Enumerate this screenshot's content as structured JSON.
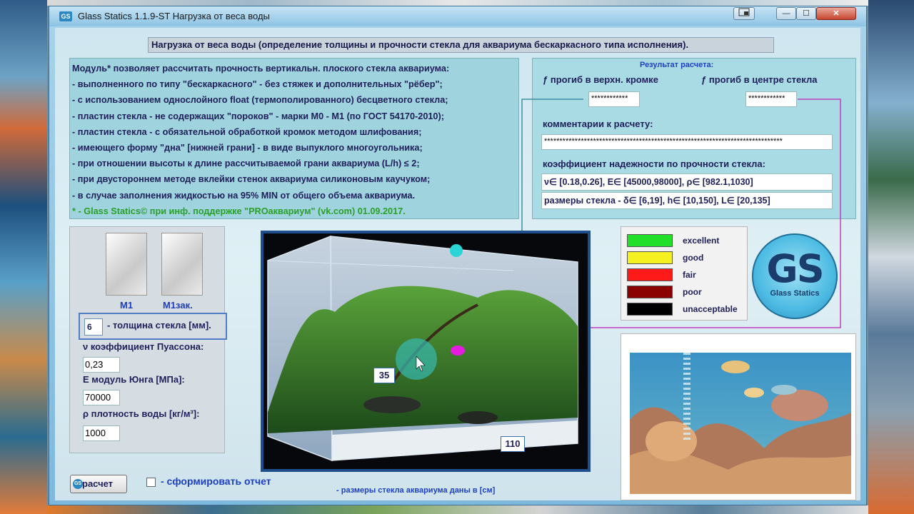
{
  "window": {
    "app_icon": "GS",
    "title": "Glass Statics 1.1.9-ST Нагрузка от веса воды",
    "controls": {
      "minimize": "—",
      "maximize": "☐",
      "close": "✕"
    }
  },
  "header": "Нагрузка от веса воды (определение толщины и прочности стекла для аквариума бескаркасного типа исполнения).",
  "description": {
    "lines": [
      "Модуль* позволяет рассчитать прочность вертикальн. плоского стекла аквариума:",
      "- выполненного  по типу \"бескаркасного\"  -  без стяжек и дополнительных \"рёбер\";",
      "- с использованием однослойного float (термополированного) бесцветного стекла;",
      "- пластин стекла  -  не содержащих \"пороков\" - марки М0 - М1 (по ГОСТ 54170-2010);",
      "- пластин стекла  -  с  обязательной  обработкой  кромок  методом  шлифования;",
      "- имеющего форму   \"дна\" [нижней грани]  -  в  виде  выпуклого многоугольника;",
      "- при отношении  высоты  к  длине  рассчитываемой грани аквариума (L/h) ≤ 2;",
      "- при двустороннем методе вклейки стенок аквариума силиконовым каучуком;",
      "- в случае  заполнения  жидкостью  на  95% MIN  от  общего объема аквариума."
    ],
    "credit": "* - Glass Statics© при инф. поддержке \"PROаквариум\" (vk.com) 01.09.2017."
  },
  "results": {
    "title": "Результат расчета:",
    "deflection_top_label": "ƒ прогиб в верхн. кромке",
    "deflection_top_value": "************",
    "deflection_center_label": "ƒ прогиб в  центре стекла",
    "deflection_center_value": "************",
    "comments_label": "комментарии к расчету:",
    "comments_value": "******************************************************************************",
    "reliability_label": "коэффициент надежности по прочности стекла:",
    "ranges_value": "ν∈ [0.18,0.26],  E∈ [45000,98000],  ρ∈ [982.1,1030]",
    "dimensions_value": "размеры стекла - δ∈ [6,19],  h∈ [10,150],  L∈ [20,135]"
  },
  "glass": {
    "grade_m1": "М1",
    "grade_m1_temp": "М1зак.",
    "thickness_value": "6",
    "thickness_label": "- толщина стекла [мм].",
    "poisson_label": "ν коэффициент   Пуассона:",
    "poisson_value": "0,23",
    "young_label": "E     модуль  Юнга   [МПа]:",
    "young_value": "70000",
    "density_label": "ρ плотность  воды   [кг/м³]:",
    "density_value": "1000"
  },
  "tank": {
    "height_value": "35",
    "length_value": "110"
  },
  "legend": [
    {
      "label": "excellent",
      "color": "#22e02a"
    },
    {
      "label": "good",
      "color": "#f5f01f"
    },
    {
      "label": "fair",
      "color": "#ff1a1a"
    },
    {
      "label": "poor",
      "color": "#8b0000"
    },
    {
      "label": "unacceptable",
      "color": "#000000"
    }
  ],
  "logo": {
    "letters": "GS",
    "caption": "Glass Statics"
  },
  "actions": {
    "calc_button": "расчет",
    "calc_icon": "GS",
    "report_label": "- сформировать отчет"
  },
  "footnote": "- размеры стекла аквариума даны в [см]",
  "colors": {
    "accent_blue": "#1e40c0",
    "text_navy": "#1f1f5a",
    "credit_green": "#2aa02a",
    "connector_teal": "#3a8fa0",
    "connector_magenta": "#c040c0"
  }
}
